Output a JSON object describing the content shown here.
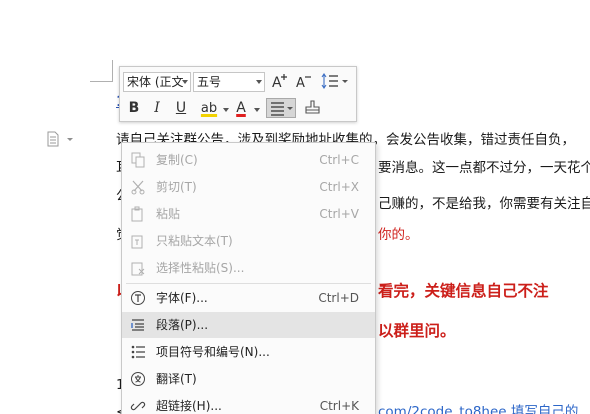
{
  "document": {
    "heading_fragment": "1",
    "lines": [
      {
        "text": "请自己关注群公告，涉及到奖励地址收集的，会发公告收集，错过责任自负，",
        "style": "normal"
      },
      {
        "text": "耳",
        "style": "normal"
      },
      {
        "text": "公",
        "style": "normal"
      },
      {
        "text": "觉",
        "style": "normal"
      },
      {
        "text": "以",
        "style": "bold-red"
      },
      {
        "text": "1",
        "style": "normal"
      },
      {
        "text": "1",
        "style": "normal"
      },
      {
        "text": "<",
        "style": "normal"
      }
    ],
    "right_fragments": {
      "line2": "要消息。这一点都不过分，一天花个",
      "line3": "己赚的，不是给我，你需要有关注自",
      "line4": "你的。",
      "line5": "看完，关键信息自己不注",
      "line6": "以群里问。",
      "line8": "com/2code_to8hee 填写自己的"
    },
    "colors": {
      "text": "#1a1a1a",
      "red": "#d0221e",
      "link": "#2c66c8"
    }
  },
  "toolbar": {
    "font_name": "宋体 (正文",
    "font_size": "五号",
    "grow_font_icon": "A⁺",
    "shrink_font_icon": "A⁻",
    "bold": "B",
    "italic": "I",
    "underline": "U",
    "highlight": "ab",
    "font_color": "A"
  },
  "menu": {
    "items": [
      {
        "label": "复制(C)",
        "shortcut": "Ctrl+C",
        "icon": "copy-icon",
        "disabled": true
      },
      {
        "label": "剪切(T)",
        "shortcut": "Ctrl+X",
        "icon": "cut-icon",
        "disabled": true
      },
      {
        "label": "粘贴",
        "shortcut": "Ctrl+V",
        "icon": "paste-icon",
        "disabled": true
      },
      {
        "label": "只粘贴文本(T)",
        "shortcut": "",
        "icon": "paste-text-icon",
        "disabled": true
      },
      {
        "label": "选择性粘贴(S)...",
        "shortcut": "",
        "icon": "paste-special-icon",
        "disabled": true
      },
      {
        "label": "字体(F)...",
        "shortcut": "Ctrl+D",
        "icon": "font-icon",
        "disabled": false
      },
      {
        "label": "段落(P)...",
        "shortcut": "",
        "icon": "paragraph-icon",
        "disabled": false,
        "hover": true
      },
      {
        "label": "项目符号和编号(N)...",
        "shortcut": "",
        "icon": "bullets-icon",
        "disabled": false
      },
      {
        "label": "翻译(T)",
        "shortcut": "",
        "icon": "translate-icon",
        "disabled": false
      },
      {
        "label": "超链接(H)...",
        "shortcut": "Ctrl+K",
        "icon": "hyperlink-icon",
        "disabled": false
      }
    ]
  }
}
